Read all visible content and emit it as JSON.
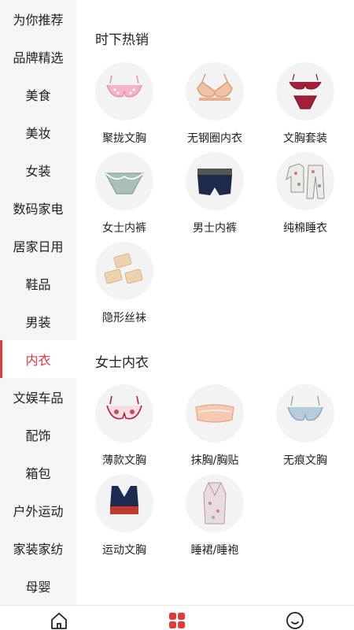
{
  "sidebar": {
    "items": [
      {
        "label": "为你推荐"
      },
      {
        "label": "品牌精选"
      },
      {
        "label": "美食"
      },
      {
        "label": "美妆"
      },
      {
        "label": "女装"
      },
      {
        "label": "数码家电"
      },
      {
        "label": "居家日用"
      },
      {
        "label": "鞋品"
      },
      {
        "label": "男装"
      },
      {
        "label": "内衣"
      },
      {
        "label": "文娱车品"
      },
      {
        "label": "配饰"
      },
      {
        "label": "箱包"
      },
      {
        "label": "户外运动"
      },
      {
        "label": "家装家纺"
      },
      {
        "label": "母婴"
      }
    ],
    "active_index": 9
  },
  "sections": [
    {
      "title": "时下热销",
      "items": [
        {
          "label": "聚拢文胸",
          "icon": "pink-lace-bra-icon"
        },
        {
          "label": "无钢圈内衣",
          "icon": "nude-bra-icon"
        },
        {
          "label": "文胸套装",
          "icon": "red-lingerie-set-icon"
        },
        {
          "label": "女士内裤",
          "icon": "women-panties-icon"
        },
        {
          "label": "男士内裤",
          "icon": "men-briefs-icon"
        },
        {
          "label": "纯棉睡衣",
          "icon": "cotton-pajamas-icon"
        },
        {
          "label": "隐形丝袜",
          "icon": "invisible-stockings-icon"
        }
      ]
    },
    {
      "title": "女士内衣",
      "items": [
        {
          "label": "薄款文胸",
          "icon": "thin-bra-icon"
        },
        {
          "label": "抹胸/胸贴",
          "icon": "tube-bra-icon"
        },
        {
          "label": "无痕文胸",
          "icon": "seamless-bra-icon"
        },
        {
          "label": "运动文胸",
          "icon": "sports-bra-icon"
        },
        {
          "label": "睡裙/睡袍",
          "icon": "robe-icon"
        }
      ]
    }
  ],
  "tabbar": {
    "tabs": [
      {
        "icon": "home-icon"
      },
      {
        "icon": "category-grid-icon"
      },
      {
        "icon": "profile-smile-icon"
      }
    ],
    "active_index": 1
  },
  "colors": {
    "accent": "#e0393e",
    "sidebar_bg": "#f5f5f5",
    "thumb_bg": "#f3f3f3"
  }
}
